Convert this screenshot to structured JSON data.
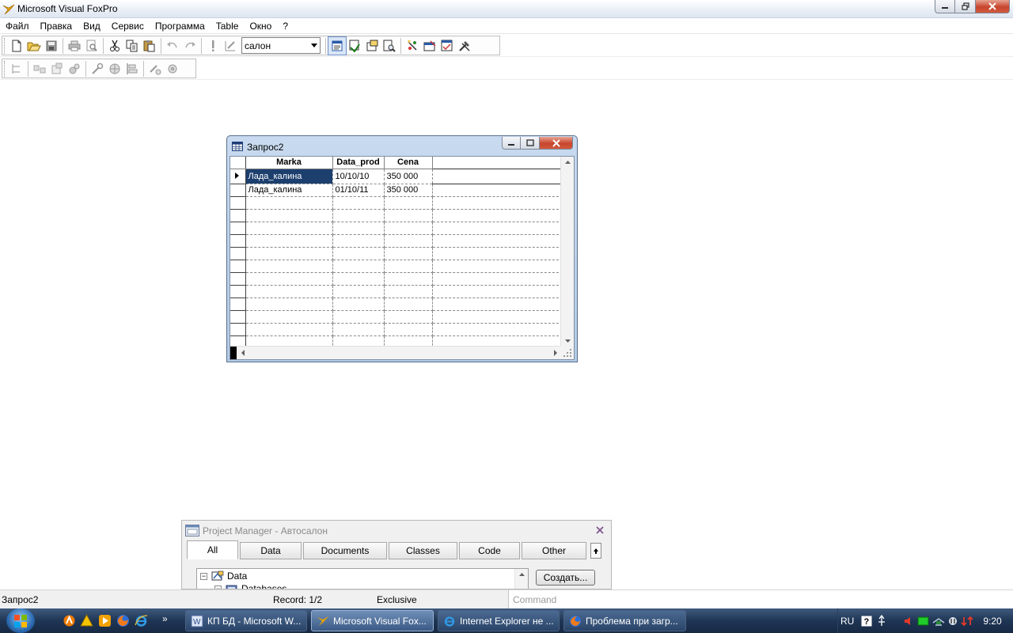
{
  "app": {
    "title": "Microsoft Visual FoxPro"
  },
  "menu": [
    "Файл",
    "Правка",
    "Вид",
    "Сервис",
    "Программа",
    "Table",
    "Окно",
    "?"
  ],
  "toolbar": {
    "database_combo_value": "салон"
  },
  "browse_window": {
    "title": "Запрос2",
    "columns": [
      "Marka",
      "Data_prod",
      "Cena"
    ],
    "rows": [
      [
        "Лада_калина",
        "10/10/10",
        "350 000"
      ],
      [
        "Лада_калина",
        "01/10/11",
        "350 000"
      ]
    ]
  },
  "project_manager": {
    "title": "Project Manager - Автосалон",
    "tabs": [
      "All",
      "Data",
      "Documents",
      "Classes",
      "Code",
      "Other"
    ],
    "tree": [
      "Data",
      "Databases"
    ],
    "create_button": "Создать..."
  },
  "status": {
    "window_name": "Запрос2",
    "record": "Record: 1/2",
    "mode": "Exclusive",
    "command_placeholder": "Command"
  },
  "taskbar": {
    "tasks": [
      "КП БД - Microsoft W...",
      "Microsoft Visual Fox...",
      "Internet Explorer не ...",
      "Проблема при загр..."
    ],
    "language": "RU",
    "clock": "9:20"
  },
  "colors": {
    "selected_cell": "#1c3f6e",
    "taskbar": "#1f3554",
    "window_frame": "#c8daef"
  }
}
